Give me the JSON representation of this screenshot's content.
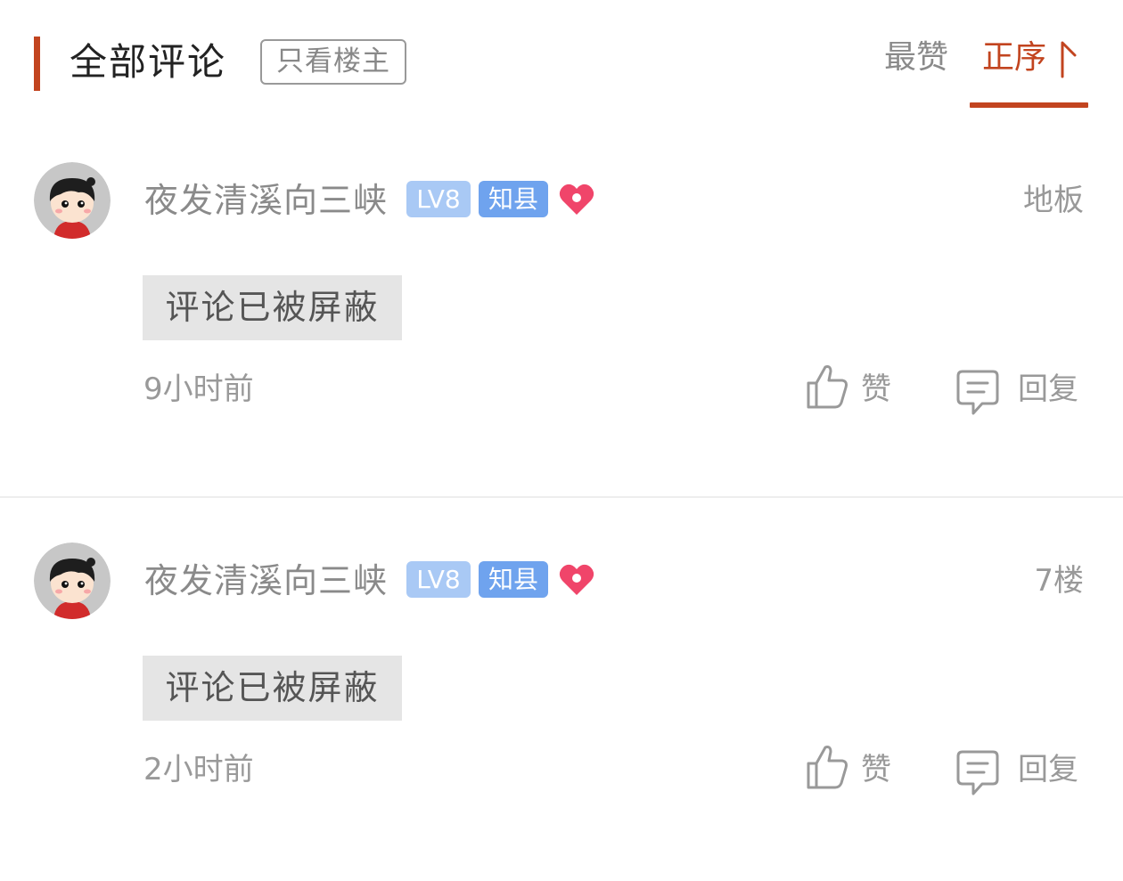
{
  "header": {
    "title": "全部评论",
    "op_only_label": "只看楼主",
    "tabs": [
      {
        "label": "最赞",
        "active": false
      },
      {
        "label": "正序",
        "active": true
      }
    ],
    "accent_color": "#c2441f"
  },
  "comments": [
    {
      "username": "夜发清溪向三峡",
      "level": "LV8",
      "title_badge": "知县",
      "floor": "地板",
      "content": "评论已被屏蔽",
      "time": "9小时前",
      "like_label": "赞",
      "reply_label": "回复"
    },
    {
      "username": "夜发清溪向三峡",
      "level": "LV8",
      "title_badge": "知县",
      "floor": "7楼",
      "content": "评论已被屏蔽",
      "time": "2小时前",
      "like_label": "赞",
      "reply_label": "回复"
    }
  ],
  "icons": {
    "avatar": "cartoon-avatar",
    "heart": "heart-icon",
    "like": "thumbs-up-icon",
    "reply": "comment-bubble-icon",
    "sort": "sort-up-arrow-icon"
  },
  "colors": {
    "level_badge": "#a9c9f5",
    "title_badge": "#6fa3ee",
    "heart": "#f0456a",
    "blocked_bg": "#e5e5e5"
  }
}
